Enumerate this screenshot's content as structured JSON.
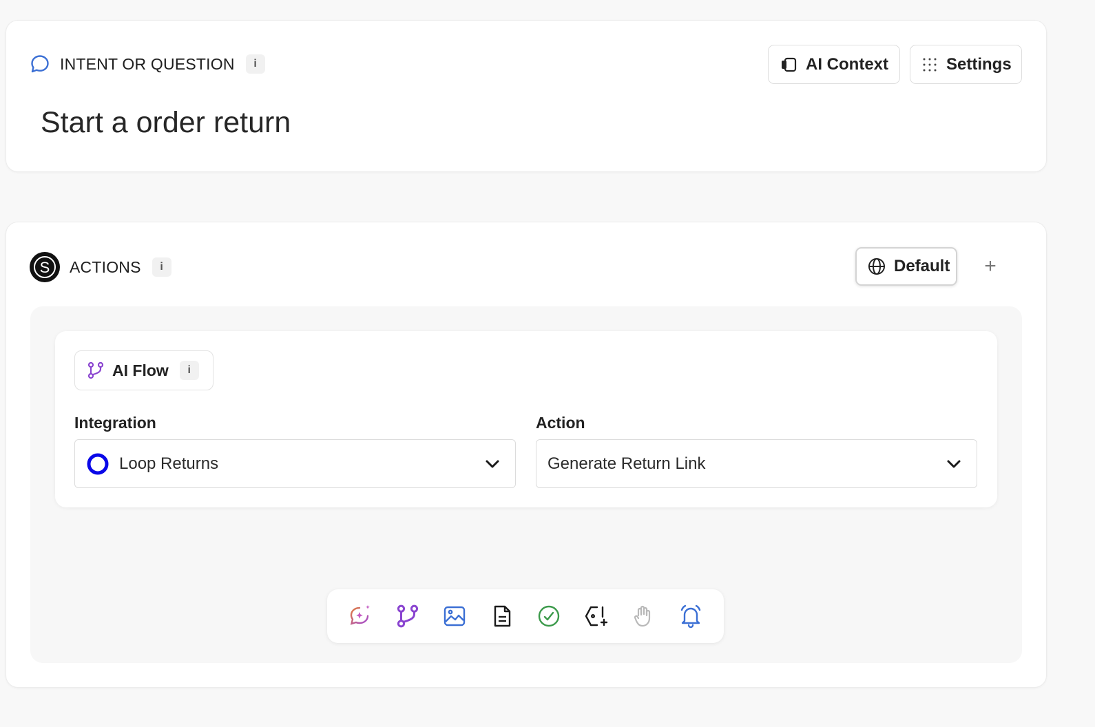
{
  "intent": {
    "section_title": "INTENT OR QUESTION",
    "info": "i",
    "text": "Start a order return",
    "ai_context_label": "AI Context",
    "settings_label": "Settings"
  },
  "actions": {
    "section_title": "ACTIONS",
    "info": "i",
    "default_label": "Default",
    "add_label": "+",
    "flow": {
      "chip_label": "AI Flow",
      "info": "i",
      "integration_label": "Integration",
      "integration_value": "Loop Returns",
      "action_label": "Action",
      "action_value": "Generate Return Link"
    },
    "toolbar_icons": [
      "ai-chat-icon",
      "ai-flow-icon",
      "image-icon",
      "document-icon",
      "check-circle-icon",
      "tag-plus-icon",
      "hand-icon",
      "bell-icon"
    ]
  },
  "colors": {
    "accent_blue": "#3b6fd4",
    "purple": "#8a44d0",
    "loop_blue": "#0a08e8",
    "green": "#3c9a4b"
  }
}
